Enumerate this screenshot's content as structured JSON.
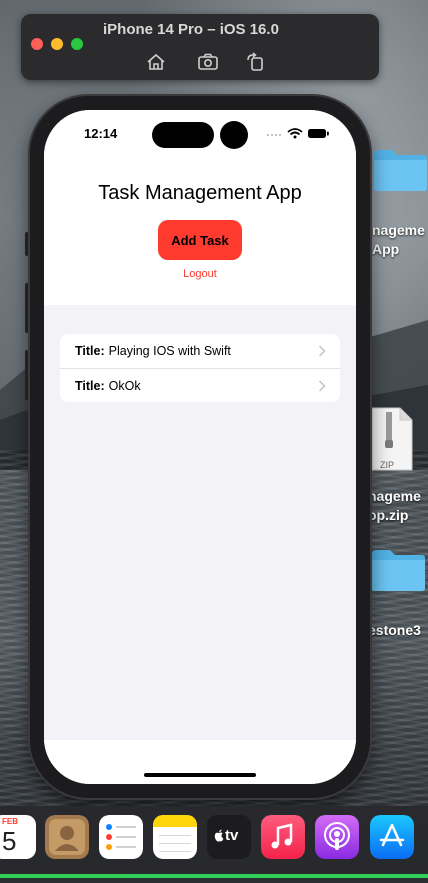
{
  "simulator": {
    "title": "iPhone 14 Pro – iOS 16.0",
    "toolbar_icons": [
      "home-icon",
      "screenshot-icon",
      "rotate-icon"
    ]
  },
  "desktop": {
    "items": [
      {
        "label_line1": "nageme",
        "label_line2": "App",
        "icon": "folder-icon"
      },
      {
        "label_line1": "nageme",
        "label_line2": "op.zip",
        "icon": "zip-file-icon",
        "badge": "ZIP"
      },
      {
        "label_line1": "estone3",
        "icon": "folder-icon"
      }
    ]
  },
  "status_bar": {
    "time": "12:14"
  },
  "app": {
    "title": "Task Management App",
    "add_button": "Add Task",
    "logout": "Logout",
    "tasks": [
      {
        "label": "Title:",
        "value": "Playing IOS with Swift"
      },
      {
        "label": "Title:",
        "value": "OkOk"
      }
    ]
  },
  "dock": {
    "calendar_month": "FEB",
    "calendar_day": "5",
    "tv_label": "tv",
    "apps": [
      "calendar-icon",
      "contacts-icon",
      "reminders-icon",
      "notes-icon",
      "apple-tv-icon",
      "music-icon",
      "podcasts-icon",
      "app-store-icon"
    ]
  },
  "colors": {
    "accent": "#ff3b30",
    "screen_background": "#f2f2f7"
  }
}
